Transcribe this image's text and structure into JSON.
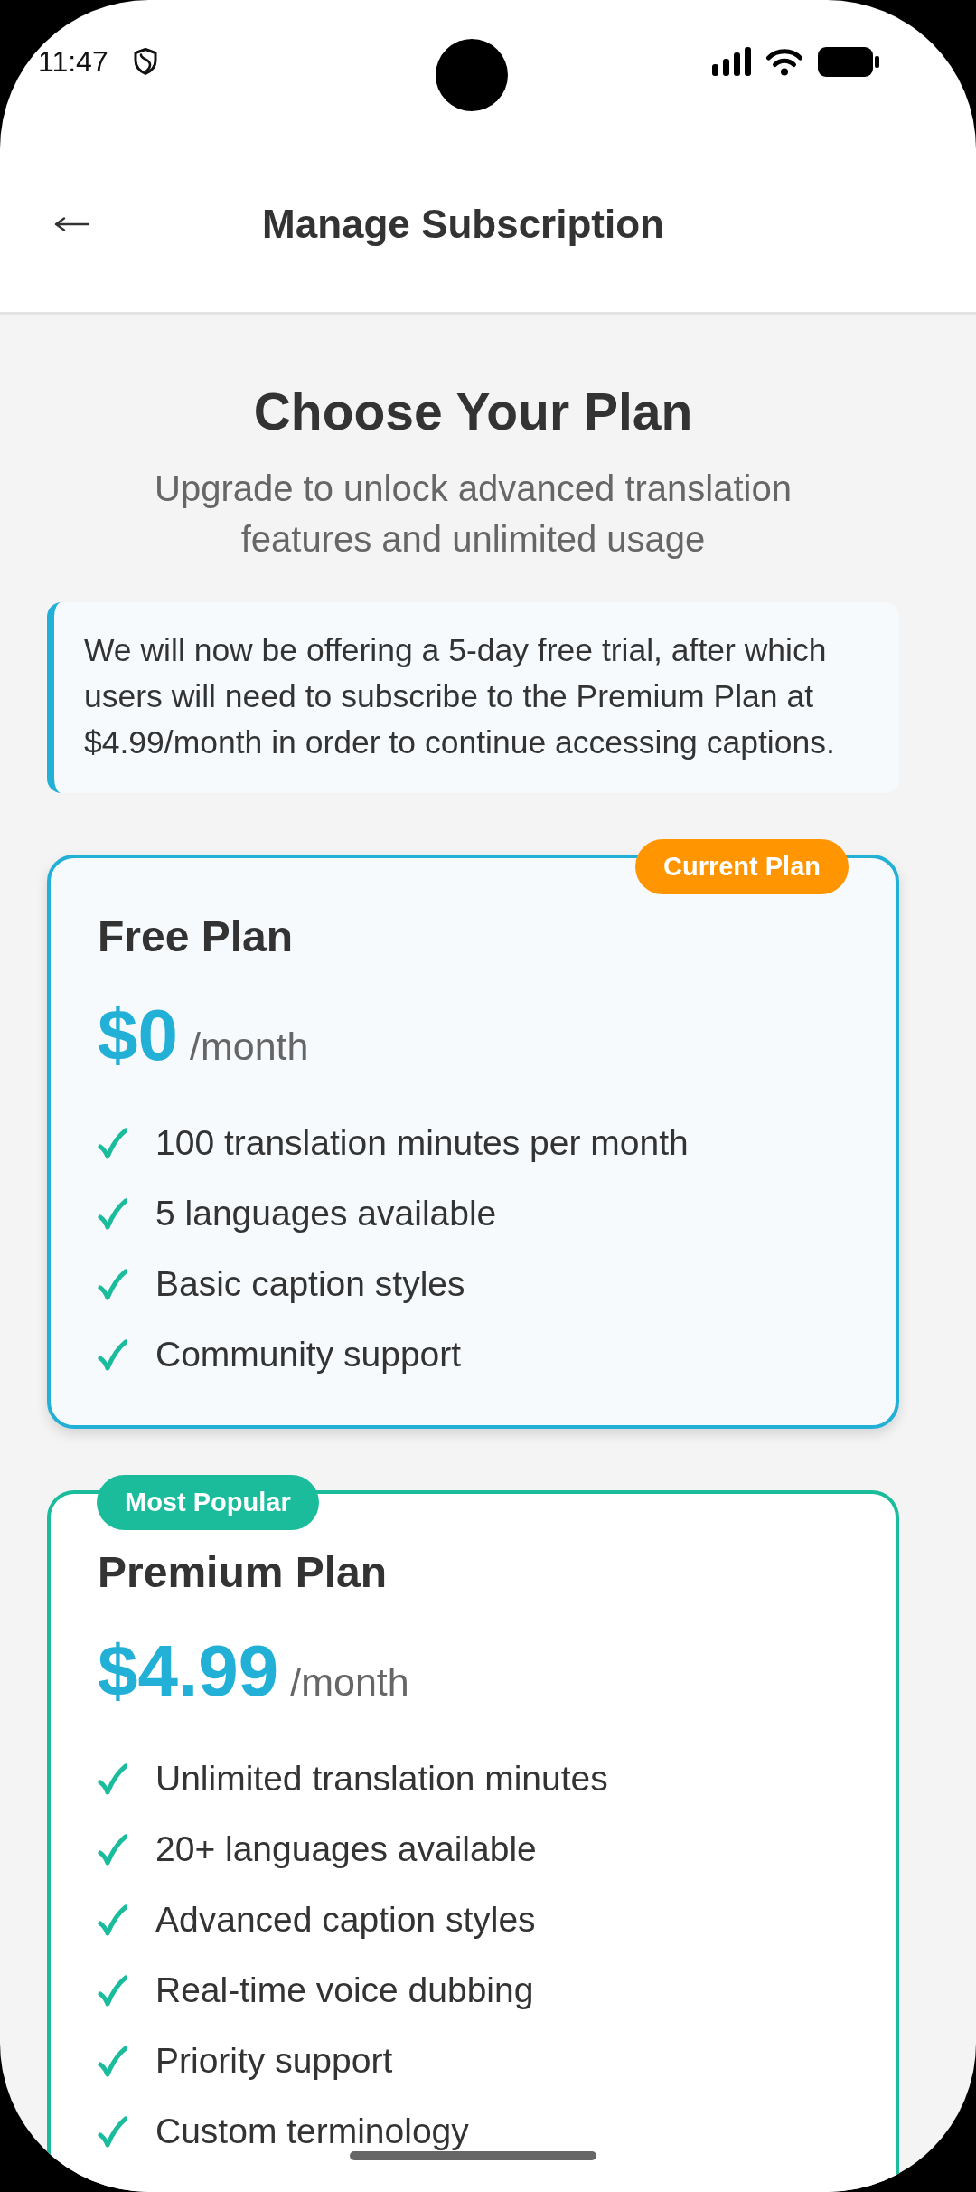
{
  "status_bar": {
    "time": "11:47"
  },
  "header": {
    "title": "Manage Subscription"
  },
  "intro": {
    "title": "Choose Your Plan",
    "subtitle": "Upgrade to unlock advanced translation features and unlimited usage"
  },
  "notice": {
    "text": "We will now be offering a 5-day free trial, after which users will need to subscribe to the Premium Plan at $4.99/month in order to continue accessing captions."
  },
  "plans": [
    {
      "kind": "current",
      "badge": "Current Plan",
      "name": "Free Plan",
      "price": "$0",
      "period": "/month",
      "features": [
        "100 translation minutes per month",
        "5 languages available",
        "Basic caption styles",
        "Community support"
      ]
    },
    {
      "kind": "popular",
      "badge": "Most Popular",
      "name": "Premium Plan",
      "price": "$4.99",
      "period": "/month",
      "features": [
        "Unlimited translation minutes",
        "20+ languages available",
        "Advanced caption styles",
        "Real-time voice dubbing",
        "Priority support",
        "Custom terminology"
      ]
    }
  ]
}
